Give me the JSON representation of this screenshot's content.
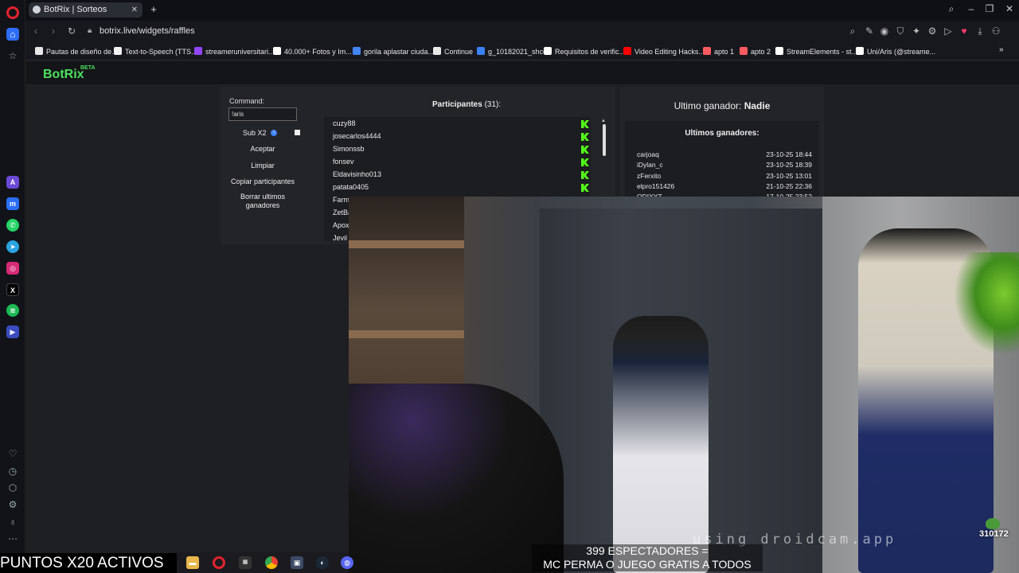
{
  "browser": {
    "tab_title": "BotRix | Sorteos",
    "url": "botrix.live/widgets/raffles",
    "bookmarks": [
      {
        "label": "Pautas de diseño de...",
        "color": "#e8e8e8"
      },
      {
        "label": "Text-to-Speech (TTS...",
        "color": "#f2f2f2"
      },
      {
        "label": "streameruniversitari...",
        "color": "#9146ff"
      },
      {
        "label": "40.000+ Fotos y Im...",
        "color": "#ffffff"
      },
      {
        "label": "gorila aplastar ciuda...",
        "color": "#4285f4"
      },
      {
        "label": "Continue",
        "color": "#e8e8e8"
      },
      {
        "label": "g_10182021_shcc",
        "color": "#3b82f6"
      },
      {
        "label": "Requisitos de verific...",
        "color": "#ffffff"
      },
      {
        "label": "Video Editing Hacks...",
        "color": "#ff0000"
      },
      {
        "label": "apto 1",
        "color": "#ff5a5f"
      },
      {
        "label": "apto 2",
        "color": "#ff5a5f"
      },
      {
        "label": "StreamElements - st...",
        "color": "#ffffff"
      },
      {
        "label": "Uni/Aris (@streame...",
        "color": "#ffffff"
      }
    ]
  },
  "app": {
    "brand": "BotRix",
    "brand_tag": "BETA"
  },
  "controls": {
    "command_label": "Command:",
    "command_value": "!aris",
    "sub_label": "Sub X2",
    "accept_button": "Aceptar",
    "clear_button": "Limpiar",
    "copy_button": "Copiar participantes",
    "delete_button": "Borrar ultimos ganadores"
  },
  "participants": {
    "title": "Participantes",
    "count": "(31):",
    "items": [
      "cuzy88",
      "josecarlos4444",
      "Simonssb",
      "fonsev",
      "Eldavisinho013",
      "patata0405",
      "Farm",
      "ZetBa",
      "Apox",
      "Jevil"
    ]
  },
  "winner": {
    "label": "Ultimo ganador:",
    "name": "Nadie"
  },
  "recent_winners": {
    "title": "Ultimos ganadores:",
    "items": [
      {
        "name": "carjoaq",
        "date": "23-10-25 18:44"
      },
      {
        "name": "iDylan_c",
        "date": "23-10-25 18:39"
      },
      {
        "name": "zFerxito",
        "date": "23-10-25 13:01"
      },
      {
        "name": "elpro151426",
        "date": "21-10-25 22:36"
      },
      {
        "name": "ODIXYT",
        "date": "17-10-25 23:52"
      }
    ]
  },
  "stream": {
    "watermark": "using droidcam.app",
    "counter": "310172",
    "caption_line1": "399 ESPECTADORES =",
    "caption_line2": "MC PERMA O JUEGO GRATIS A TODOS",
    "points_banner": "PUNTOS X20 ACTIVOS"
  }
}
